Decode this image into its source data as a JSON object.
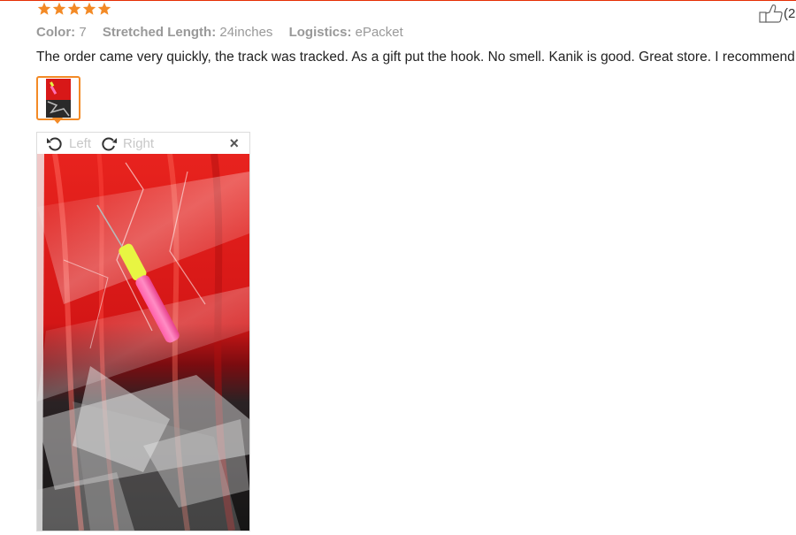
{
  "review": {
    "rating": 5,
    "rating_max": 5,
    "star_color": "#f38a26",
    "helpful_count": "(2",
    "attributes": [
      {
        "key": "Color:",
        "value": "7"
      },
      {
        "key": "Stretched Length:",
        "value": "24inches"
      },
      {
        "key": "Logistics:",
        "value": "ePacket"
      }
    ],
    "text": "The order came very quickly, the track was tracked. As a gift put the hook. No smell. Kanik is good. Great store. I recommend."
  },
  "viewer": {
    "rotate_left_label": "Left",
    "rotate_right_label": "Right",
    "close_glyph": "×",
    "active_thumb_border": "#f38a26"
  },
  "icons": {
    "star": "star-icon",
    "thumbs_up": "thumbs-up-icon",
    "rotate_left": "rotate-left-icon",
    "rotate_right": "rotate-right-icon",
    "close": "close-icon"
  }
}
